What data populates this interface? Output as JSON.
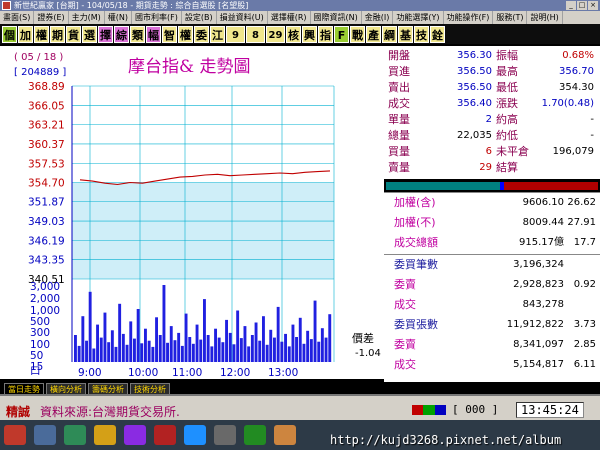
{
  "window": {
    "title": "新世紀贏家 [台期] - 104/05/18 - 期貨走勢 : 綜合自選股 [名望股]"
  },
  "menu": [
    "畫面(S)",
    "證券(E)",
    "主力(M)",
    "權(N)",
    "國市利率(F)",
    "設定(B)",
    "損益資料(U)",
    "選擇權(R)",
    "國際資訊(N)",
    "金融(I)",
    "功能選擇(Y)",
    "功能操作(F)",
    "服務(T)",
    "說明(H)"
  ],
  "toolbar": {
    "buttons": [
      {
        "label": "個",
        "color": "#9acd32"
      },
      {
        "label": "加",
        "color": "#f0e68c"
      },
      {
        "label": "權",
        "color": "#f0e68c"
      },
      {
        "label": "期",
        "color": "#f0e68c"
      },
      {
        "label": "貨",
        "color": "#f0e68c"
      },
      {
        "label": "選",
        "color": "#f0e68c"
      },
      {
        "label": "擇",
        "color": "#da70d6"
      },
      {
        "label": "綜",
        "color": "#da70d6"
      },
      {
        "label": "類",
        "color": "#f0e68c"
      },
      {
        "label": "幅",
        "color": "#da70d6"
      },
      {
        "label": "智",
        "color": "#f0e68c"
      },
      {
        "label": "權",
        "color": "#f0e68c"
      },
      {
        "label": "委",
        "color": "#f0e68c"
      },
      {
        "label": "江",
        "color": "#f0e68c"
      },
      {
        "label": "9",
        "color": "#f0e68c"
      },
      {
        "label": "8",
        "color": "#f0e68c"
      },
      {
        "label": "29",
        "color": "#f0e68c"
      },
      {
        "label": "核",
        "color": "#f0e68c"
      },
      {
        "label": "興",
        "color": "#f0e68c"
      },
      {
        "label": "指",
        "color": "#f0e68c"
      },
      {
        "label": "F",
        "color": "#9acd32"
      },
      {
        "label": "戰",
        "color": "#f0e68c"
      },
      {
        "label": "產",
        "color": "#f0e68c"
      },
      {
        "label": "綱",
        "color": "#f0e68c"
      },
      {
        "label": "基",
        "color": "#f0e68c"
      },
      {
        "label": "技",
        "color": "#f0e68c"
      },
      {
        "label": "銓",
        "color": "#f0e68c"
      }
    ]
  },
  "chart_header": {
    "date": "( 05 / 18 )",
    "code": "[ 204889 ]",
    "title": "摩台指&  走勢圖"
  },
  "chart_data": [
    {
      "type": "line",
      "title": "摩台指&  走勢圖",
      "y_ticks": [
        "368.89",
        "366.05",
        "363.21",
        "360.37",
        "357.53",
        "354.70",
        "351.87",
        "349.03",
        "346.19",
        "343.35",
        "340.51"
      ],
      "ylim": [
        340.51,
        368.89
      ],
      "reference": 354.7,
      "x_ticks": [
        "9:00",
        "10:00",
        "11:00",
        "12:00",
        "13:00"
      ],
      "x": [
        "8:45",
        "9:00",
        "9:15",
        "9:30",
        "9:45",
        "10:00",
        "10:15",
        "10:30",
        "10:45",
        "11:00",
        "11:15",
        "11:30",
        "11:45",
        "12:00",
        "12:15",
        "12:30",
        "12:45",
        "13:00",
        "13:15",
        "13:30",
        "13:45"
      ],
      "values": [
        355.1,
        354.9,
        354.6,
        354.4,
        354.7,
        354.6,
        354.9,
        355.2,
        355.5,
        355.6,
        355.8,
        355.9,
        355.7,
        355.8,
        355.9,
        356.0,
        356.1,
        356.0,
        356.2,
        356.3,
        356.4
      ]
    },
    {
      "type": "bar",
      "title": "",
      "y_ticks": [
        "3,000",
        "2,000",
        "1,000",
        "500",
        "300",
        "100",
        "50",
        "15",
        "口"
      ],
      "ylim": [
        0,
        3000
      ],
      "x_ticks": [
        "9:00",
        "10:00",
        "11:00",
        "12:00",
        "13:00"
      ],
      "values": [
        520,
        310,
        880,
        410,
        1350,
        260,
        720,
        470,
        950,
        380,
        610,
        290,
        1120,
        540,
        330,
        780,
        450,
        1020,
        360,
        640,
        410,
        290,
        860,
        520,
        1480,
        370,
        690,
        420,
        560,
        310,
        930,
        480,
        350,
        720,
        430,
        1210,
        520,
        300,
        640,
        470,
        380,
        810,
        560,
        340,
        990,
        460,
        690,
        300,
        520,
        760,
        410,
        880,
        330,
        620,
        470,
        1060,
        390,
        540,
        300,
        720,
        480,
        850,
        350,
        600,
        440,
        1180,
        390,
        650,
        470,
        920
      ]
    }
  ],
  "price_diff": {
    "label": "價差",
    "value": "-1.04"
  },
  "quote": {
    "rows": [
      {
        "l": "開盤",
        "v": "356.30",
        "l2": "振幅",
        "v2": "0.68%",
        "c": "#0000c0",
        "c2": "#c00000"
      },
      {
        "l": "買進",
        "v": "356.50",
        "l2": "最高",
        "v2": "356.70",
        "c": "#0000c0",
        "c2": "#0000c0"
      },
      {
        "l": "賣出",
        "v": "356.50",
        "l2": "最低",
        "v2": "354.30",
        "c": "#0000c0",
        "c2": "#000000"
      },
      {
        "l": "成交",
        "v": "356.40",
        "l2": "漲跌",
        "v2": "1.70(0.48)",
        "c": "#0000c0",
        "c2": "#0000c0"
      },
      {
        "l": "單量",
        "v": "2",
        "l2": "約高",
        "v2": "-",
        "c": "#0000c0",
        "c2": "#000000"
      },
      {
        "l": "總量",
        "v": "22,035",
        "l2": "約低",
        "v2": "-",
        "c": "#000000",
        "c2": "#000000"
      },
      {
        "l": "買量",
        "v": "6",
        "l2": "未平倉",
        "v2": "196,079",
        "c": "#c00000",
        "c2": "#000000"
      },
      {
        "l": "賣量",
        "v": "29",
        "l2": "結算",
        "v2": "",
        "c": "#c00000",
        "c2": "#000000"
      }
    ]
  },
  "market": {
    "rows": [
      {
        "l": "加權(含)",
        "v": "9606.10",
        "v2": "26.62"
      },
      {
        "l": "加權(不)",
        "v": "8009.44",
        "v2": "27.91"
      },
      {
        "l": "成交總額",
        "v": "915.17億",
        "v2": "17.7"
      }
    ]
  },
  "volume_stats": {
    "rows": [
      {
        "l": "委買筆數",
        "v": "3,196,324",
        "v2": ""
      },
      {
        "l": "委賣",
        "v": "2,928,823",
        "v2": "0.92"
      },
      {
        "l": "成交",
        "v": "843,278",
        "v2": ""
      },
      {
        "l": "委買張數",
        "v": "11,912,822",
        "v2": "3.73"
      },
      {
        "l": "委賣",
        "v": "8,341,097",
        "v2": "2.85"
      },
      {
        "l": "成交",
        "v": "5,154,817",
        "v2": "6.11"
      }
    ]
  },
  "tabs": [
    "當日走勢",
    "橫向分析",
    "籌碼分析",
    "技術分析"
  ],
  "status": {
    "tag": "精誠",
    "message": "資料來源:台灣期貨交易所.",
    "code": "[ 000  ]",
    "time": "13:45:24"
  },
  "taskbar": {
    "watermark": "http://kujd3268.pixnet.net/album"
  },
  "colors": {
    "up": "#c00000",
    "down": "#008000",
    "volume": "#2020e0",
    "grid": "#00b0d0",
    "reference_fill": "#cfeef8"
  }
}
